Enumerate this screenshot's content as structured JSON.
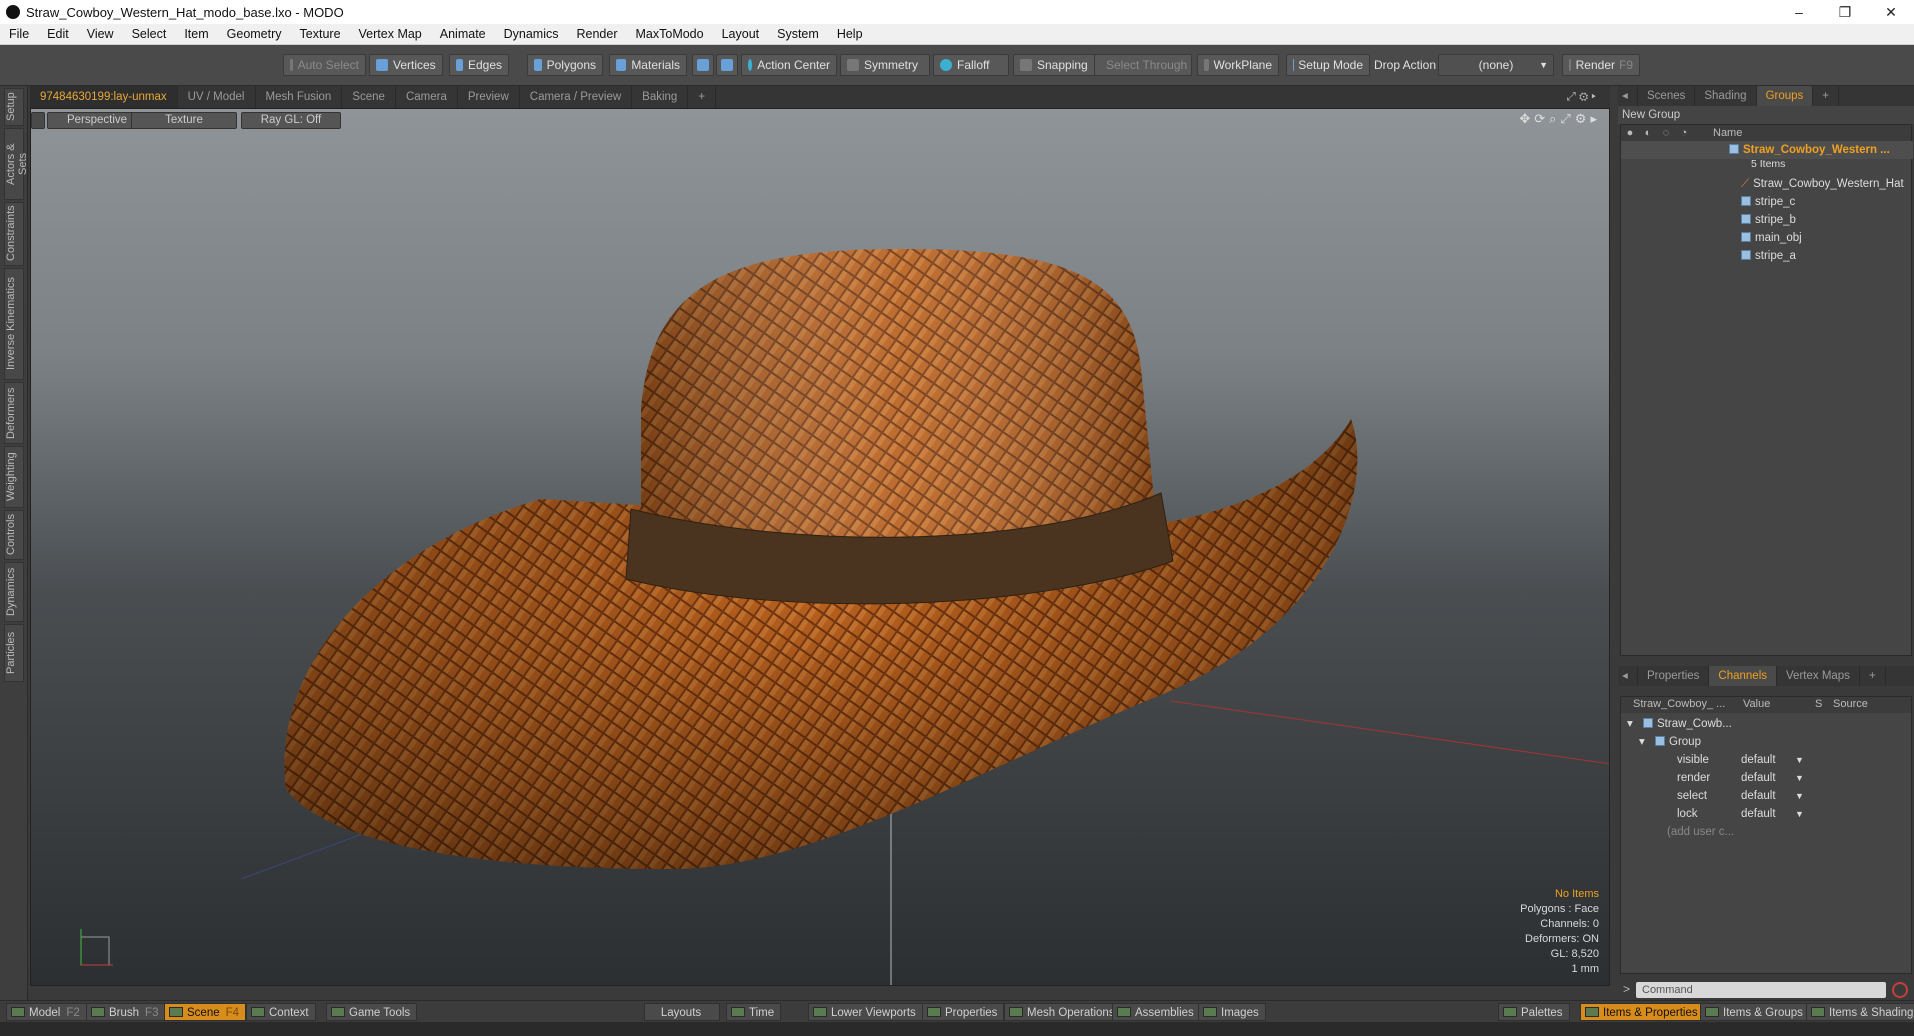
{
  "window": {
    "title": "Straw_Cowboy_Western_Hat_modo_base.lxo - MODO",
    "minimize": "–",
    "restore": "❐",
    "close": "✕"
  },
  "menu": [
    "File",
    "Edit",
    "View",
    "Select",
    "Item",
    "Geometry",
    "Texture",
    "Vertex Map",
    "Animate",
    "Dynamics",
    "Render",
    "MaxToModo",
    "Layout",
    "System",
    "Help"
  ],
  "toolbar": {
    "auto_select": "Auto Select",
    "vertices": "Vertices",
    "edges": "Edges",
    "polygons": "Polygons",
    "materials": "Materials",
    "action_center": "Action Center",
    "symmetry": "Symmetry",
    "falloff": "Falloff",
    "snapping": "Snapping",
    "select_through": "Select Through",
    "workplane": "WorkPlane",
    "setup_mode": "Setup Mode",
    "drop_action": "Drop Action",
    "drop_value": "(none)",
    "render": "Render",
    "render_key": "F9"
  },
  "left_tabs": [
    "Setup",
    "Actors & Sets",
    "Constraints",
    "Inverse Kinematics",
    "Deformers",
    "Weighting",
    "Controls",
    "Dynamics",
    "Particles"
  ],
  "viewport_tabs": [
    "97484630199:lay-unmax",
    "UV / Model",
    "Mesh Fusion",
    "Scene",
    "Camera",
    "Preview",
    "Camera / Preview",
    "Baking",
    "+"
  ],
  "viewport": {
    "perspective": "Perspective",
    "texture": "Texture",
    "raygl": "Ray GL: Off",
    "info": {
      "items": "No Items",
      "polygons": "Polygons : Face",
      "channels": "Channels: 0",
      "deformers": "Deformers: ON",
      "gl": "GL: 8,520",
      "scale": "1 mm"
    }
  },
  "right_tabs": [
    "Scenes",
    "Shading",
    "Groups",
    "+"
  ],
  "groups": {
    "new_group": "New Group",
    "col_name": "Name",
    "root": "Straw_Cowboy_Western ...",
    "root_sub": "5 Items",
    "items": [
      "Straw_Cowboy_Western_Hat",
      "stripe_c",
      "stripe_b",
      "main_obj",
      "stripe_a"
    ]
  },
  "prop_tabs": [
    "Properties",
    "Channels",
    "Vertex Maps",
    "+"
  ],
  "channels": {
    "col_item": "Straw_Cowboy_ ...",
    "col_value": "Value",
    "col_s": "S",
    "col_source": "Source",
    "root": "Straw_Cowb...",
    "group": "Group",
    "rows": [
      {
        "name": "visible",
        "value": "default"
      },
      {
        "name": "render",
        "value": "default"
      },
      {
        "name": "select",
        "value": "default"
      },
      {
        "name": "lock",
        "value": "default"
      }
    ],
    "add_user": "(add user c..."
  },
  "command": {
    "prompt": ">",
    "placeholder": "Command"
  },
  "status": {
    "model": "Model",
    "model_key": "F2",
    "brush": "Brush",
    "brush_key": "F3",
    "scene": "Scene",
    "scene_key": "F4",
    "context": "Context",
    "game_tools": "Game Tools",
    "layouts": "Layouts",
    "time": "Time",
    "lower_viewports": "Lower Viewports",
    "properties": "Properties",
    "mesh_operations": "Mesh Operations",
    "assemblies": "Assemblies",
    "images": "Images",
    "palettes": "Palettes",
    "items_properties": "Items & Properties",
    "items_groups": "Items & Groups",
    "items_shading": "Items & Shading"
  },
  "colors": {
    "accent": "#f0a020",
    "active_tab": "#d88c1c"
  }
}
